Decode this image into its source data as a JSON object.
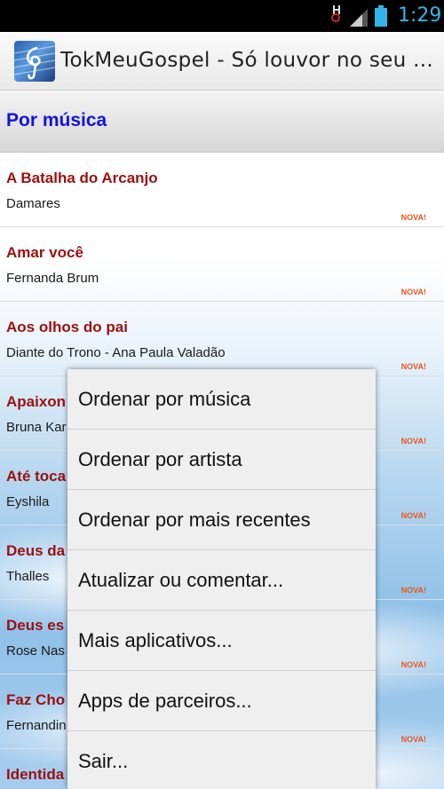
{
  "status_bar": {
    "time": "1:29",
    "icons": [
      "usb-debug-icon",
      "signal-icon",
      "battery-icon"
    ],
    "time_color": "#33b5e5"
  },
  "action_bar": {
    "title": "TokMeuGospel - Só louvor no seu ...",
    "app_icon": "music-note-icon"
  },
  "section": {
    "title": "Por música",
    "color": "#1212e0"
  },
  "songs": [
    {
      "title": "A Batalha do Arcanjo",
      "artist": "Damares",
      "badge": "NOVA!"
    },
    {
      "title": "Amar você",
      "artist": "Fernanda Brum",
      "badge": "NOVA!"
    },
    {
      "title": "Aos olhos do pai",
      "artist": "Diante do Trono - Ana Paula Valadão",
      "badge": "NOVA!"
    },
    {
      "title": "Apaixon",
      "artist": "Bruna Kar",
      "badge": "NOVA!"
    },
    {
      "title": "Até toca",
      "artist": "Eyshila",
      "badge": "NOVA!"
    },
    {
      "title": "Deus da",
      "artist": "Thalles",
      "badge": "NOVA!"
    },
    {
      "title": "Deus es",
      "artist": "Rose Nas",
      "badge": "NOVA!"
    },
    {
      "title": "Faz Cho",
      "artist": "Fernandin",
      "badge": "NOVA!"
    },
    {
      "title": "Identida",
      "artist": "",
      "badge": ""
    }
  ],
  "menu": {
    "items": [
      "Ordenar por música",
      "Ordenar por artista",
      "Ordenar por mais recentes",
      "Atualizar ou comentar...",
      "Mais aplicativos...",
      "Apps de parceiros...",
      "Sair..."
    ]
  },
  "colors": {
    "song_title": "#9b1010",
    "badge": "#e8561a"
  }
}
